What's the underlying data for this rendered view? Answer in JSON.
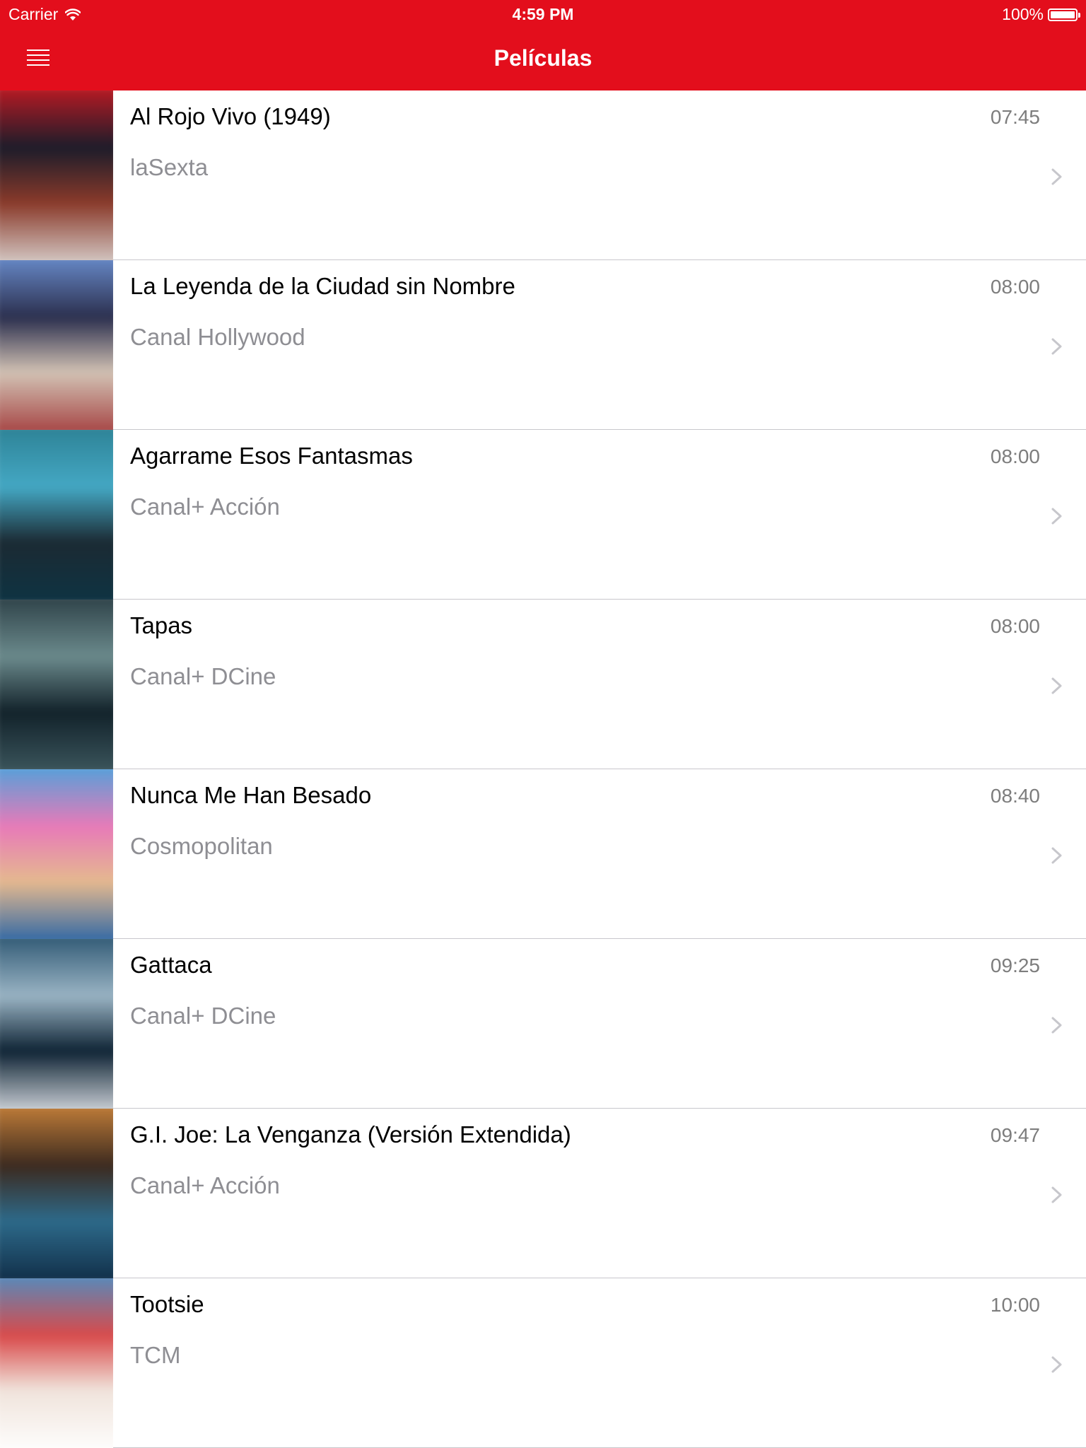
{
  "status_bar": {
    "carrier": "Carrier",
    "time": "4:59 PM",
    "battery": "100%"
  },
  "nav": {
    "title": "Películas",
    "menu_icon": "hamburger-menu-icon"
  },
  "colors": {
    "accent": "#e30e1c",
    "separator": "#c8c7cc",
    "secondary_text": "#8e8e93"
  },
  "movies": [
    {
      "title": "Al Rojo Vivo (1949)",
      "channel": "laSexta",
      "time": "07:45",
      "poster_colors": [
        "#c41a23",
        "#1c1c2a",
        "#8a3a2a",
        "#d9d2cf"
      ]
    },
    {
      "title": "La Leyenda de la Ciudad sin Nombre",
      "channel": "Canal Hollywood",
      "time": "08:00",
      "poster_colors": [
        "#6b8fd0",
        "#2b2f4e",
        "#d2c2b4",
        "#a33c3c"
      ]
    },
    {
      "title": "Agarrame Esos Fantasmas",
      "channel": "Canal+ Acción",
      "time": "08:00",
      "poster_colors": [
        "#2c8093",
        "#44a8c4",
        "#1b2a33",
        "#0d3444"
      ]
    },
    {
      "title": "Tapas",
      "channel": "Canal+ DCine",
      "time": "08:00",
      "poster_colors": [
        "#2a3d44",
        "#6b8a8c",
        "#12222a",
        "#3e5960"
      ]
    },
    {
      "title": "Nunca Me Han Besado",
      "channel": "Cosmopolitan",
      "time": "08:40",
      "poster_colors": [
        "#4aa3dc",
        "#e87ab8",
        "#e5b98f",
        "#2462a6"
      ]
    },
    {
      "title": "Gattaca",
      "channel": "Canal+ DCine",
      "time": "09:25",
      "poster_colors": [
        "#2a5470",
        "#9ab4c4",
        "#0e2334",
        "#d9dde2"
      ]
    },
    {
      "title": "G.I. Joe: La Venganza (Versión Extendida)",
      "channel": "Canal+ Acción",
      "time": "09:47",
      "poster_colors": [
        "#c9823a",
        "#3c2a1f",
        "#2d6a8a",
        "#0f2a44"
      ]
    },
    {
      "title": "Tootsie",
      "channel": "TCM",
      "time": "10:00",
      "poster_colors": [
        "#4c8fc4",
        "#d94a4a",
        "#f0e4dc",
        "#ffffff"
      ]
    }
  ]
}
